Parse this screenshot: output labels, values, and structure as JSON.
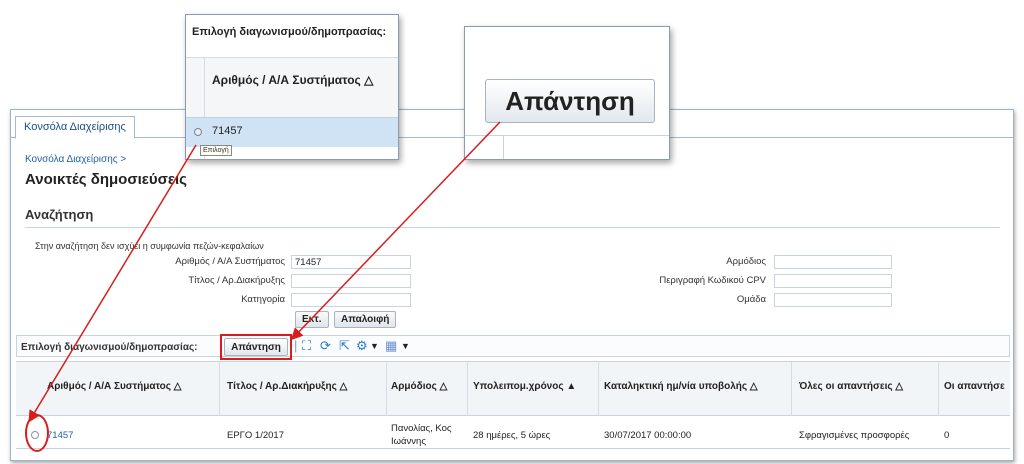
{
  "tabs": {
    "active": "Κονσόλα Διαχείρισης"
  },
  "breadcrumb": "Κονσόλα Διαχείρισης  >",
  "page_title": "Ανοικτές δημοσιεύσεις",
  "search": {
    "section_title": "Αναζήτηση",
    "hint": "Στην αναζήτηση δεν ισχύει η συμφωνία πεζών-κεφαλαίων",
    "fields": {
      "system_number": {
        "label": "Αριθμός / Α/Α Συστήματος",
        "value": "71457"
      },
      "title": {
        "label": "Τίτλος / Αρ.Διακήρυξης",
        "value": ""
      },
      "category": {
        "label": "Κατηγορία",
        "value": ""
      },
      "responsible": {
        "label": "Αρμόδιος",
        "value": ""
      },
      "cpv_description": {
        "label": "Περιγραφή Κωδικού CPV",
        "value": ""
      },
      "group": {
        "label": "Ομάδα",
        "value": ""
      }
    },
    "buttons": {
      "execute": "Εκτ.",
      "clear": "Απαλοιφή"
    }
  },
  "toolbar": {
    "select_label": "Επιλογή διαγωνισμού/δημοπρασίας:",
    "reply_button": "Απάντηση",
    "icons": [
      "fit-columns-icon",
      "refresh-icon",
      "export-icon",
      "settings-icon",
      "view-icon"
    ]
  },
  "table": {
    "headers": [
      "Αριθμός / Α/Α Συστήματος △",
      "Τίτλος / Αρ.Διακήρυξης △",
      "Αρμόδιος △",
      "Υπολειπομ.χρόνος ▲",
      "Καταληκτική ημ/νία υποβολής △",
      "Όλες οι απαντήσεις △",
      "Οι απαντήσε"
    ],
    "rows": [
      {
        "number": "71457",
        "title": "ΕΡΓΟ 1/2017",
        "responsible_line1": "Πανολίας, Κος",
        "responsible_line2": "Ιωάννης",
        "remaining": "28 ημέρες, 5 ώρες",
        "deadline": "30/07/2017 00:00:00",
        "all_replies": "Σφραγισμένες προσφορές",
        "replies": "0"
      }
    ]
  },
  "zoom_select": {
    "title": "Επιλογή διαγωνισμού/δημοπρασίας:",
    "column": "Αριθμός / Α/Α Συστήματος △",
    "value": "71457",
    "tooltip": "Επιλογή"
  },
  "zoom_reply": {
    "button": "Απάντηση"
  },
  "colors": {
    "highlight": "#d91c1c",
    "link": "#1f5fa8",
    "selection": "#cfe3f5"
  }
}
